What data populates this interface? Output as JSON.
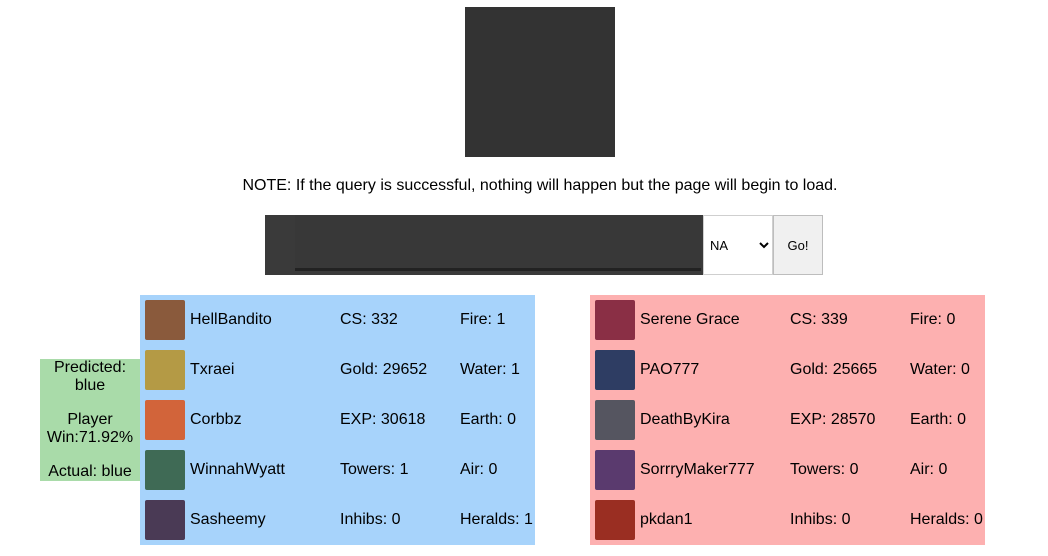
{
  "note": "NOTE: If the query is successful, nothing will happen but the page will begin to load.",
  "search": {
    "value": "",
    "region": "NA",
    "go_label": "Go!"
  },
  "prediction": {
    "predicted_label": "Predicted:",
    "predicted_value": "blue",
    "player_label": "Player",
    "player_win": "Win:71.92%",
    "actual": "Actual: blue"
  },
  "blue_team": {
    "color": "#a7d3fb",
    "players": [
      {
        "name": "HellBandito",
        "stat1": "CS: 332",
        "stat2": "Fire: 1",
        "avatar_color": "#8a5a3c"
      },
      {
        "name": "Txraei",
        "stat1": "Gold: 29652",
        "stat2": "Water: 1",
        "avatar_color": "#b49a45"
      },
      {
        "name": "Corbbz",
        "stat1": "EXP: 30618",
        "stat2": "Earth: 0",
        "avatar_color": "#d2643a"
      },
      {
        "name": "WinnahWyatt",
        "stat1": "Towers: 1",
        "stat2": "Air: 0",
        "avatar_color": "#3f6a55"
      },
      {
        "name": "Sasheemy",
        "stat1": "Inhibs: 0",
        "stat2": "Heralds: 1",
        "avatar_color": "#4a3a55"
      }
    ]
  },
  "red_team": {
    "color": "#fdb0b0",
    "players": [
      {
        "name": "Serene Grace",
        "stat1": "CS: 339",
        "stat2": "Fire: 0",
        "avatar_color": "#8a2f45"
      },
      {
        "name": "PAO777",
        "stat1": "Gold: 25665",
        "stat2": "Water: 0",
        "avatar_color": "#2e3d63"
      },
      {
        "name": "DeathByKira",
        "stat1": "EXP: 28570",
        "stat2": "Earth: 0",
        "avatar_color": "#555560"
      },
      {
        "name": "SorrryMaker777",
        "stat1": "Towers: 0",
        "stat2": "Air: 0",
        "avatar_color": "#5a3a6e"
      },
      {
        "name": "pkdan1",
        "stat1": "Inhibs: 0",
        "stat2": "Heralds: 0",
        "avatar_color": "#9a2e22"
      }
    ]
  }
}
